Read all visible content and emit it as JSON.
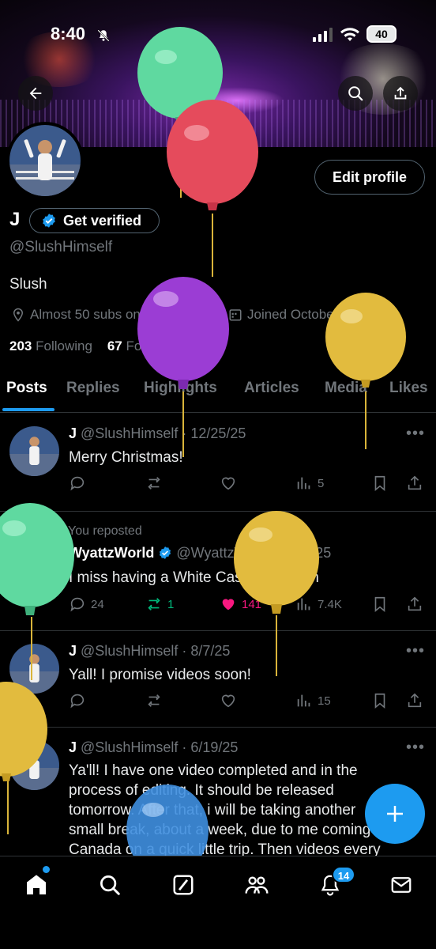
{
  "status_bar": {
    "time": "8:40",
    "battery": "40"
  },
  "profile": {
    "name": "J",
    "verify_label": "Get verified",
    "handle": "@SlushHimself",
    "bio": "Slush",
    "location": "Almost 50 subs on Youtube",
    "joined": "Joined October 2020",
    "following_count": "203",
    "following_label": "Following",
    "followers_count": "67",
    "followers_label": "Followers",
    "edit_label": "Edit profile"
  },
  "tabs": [
    "Posts",
    "Replies",
    "Highlights",
    "Articles",
    "Media",
    "Likes"
  ],
  "posts": [
    {
      "name": "J",
      "handle": "@SlushHimself",
      "date": "· 12/25/25",
      "text": "Merry Christmas!",
      "views": "5"
    },
    {
      "repost_label": "You reposted",
      "name": "WyattzWorld",
      "handle": "@WyattzWorld",
      "date": "· 8/30/25",
      "text": "I miss having a White Castle so much",
      "replies": "24",
      "reposts": "1",
      "likes": "141",
      "views": "7.4K"
    },
    {
      "name": "J",
      "handle": "@SlushHimself",
      "date": "· 8/7/25",
      "text": "Yall! I promise videos soon!",
      "views": "15"
    },
    {
      "name": "J",
      "handle": "@SlushHimself",
      "date": "· 6/19/25",
      "text_lines": [
        "Ya'll! I have one video completed and in the",
        "process of editing. It should be released",
        "tomorrow. After that, i will be taking another",
        "small break, about a week, due to me coming to",
        "Canada on a quick little trip. Then videos every"
      ]
    }
  ],
  "nav": {
    "notifications_badge": "14"
  },
  "colors": {
    "accent": "#1d9bf0",
    "like": "#f91880",
    "repost": "#00ba7c",
    "muted": "#71767b"
  }
}
